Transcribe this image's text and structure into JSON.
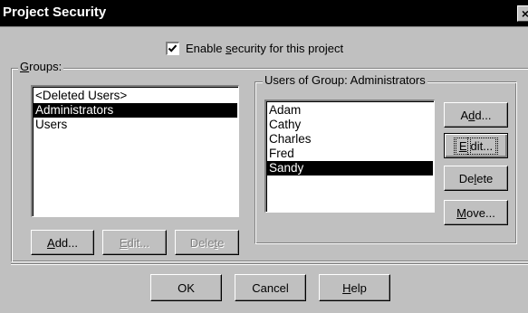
{
  "window": {
    "title": "Project Security",
    "close_label": "×"
  },
  "security": {
    "enable_checked": true,
    "enable_label_pre": "Enable ",
    "enable_label_accel": "s",
    "enable_label_post": "ecurity for this project"
  },
  "groups": {
    "legend_accel": "G",
    "legend_post": "roups:",
    "items": [
      "<Deleted Users>",
      "Administrators",
      "Users"
    ],
    "selected_index": 1,
    "buttons": {
      "add_accel": "A",
      "add_post": "dd...",
      "edit_accel": "E",
      "edit_post": "dit...",
      "delete_pre": "Dele",
      "delete_accel": "t",
      "delete_post": "e"
    }
  },
  "users": {
    "legend": "Users of Group: Administrators",
    "items": [
      "Adam",
      "Cathy",
      "Charles",
      "Fred",
      "Sandy"
    ],
    "selected_index": 4,
    "buttons": {
      "add_pre": "A",
      "add_accel": "d",
      "add_post": "d...",
      "edit_accel": "E",
      "edit_post": "dit...",
      "delete_pre": "De",
      "delete_accel": "l",
      "delete_post": "ete",
      "move_accel": "M",
      "move_post": "ove..."
    }
  },
  "footer": {
    "ok_label": "OK",
    "cancel_label": "Cancel",
    "help_accel": "H",
    "help_post": "elp"
  }
}
